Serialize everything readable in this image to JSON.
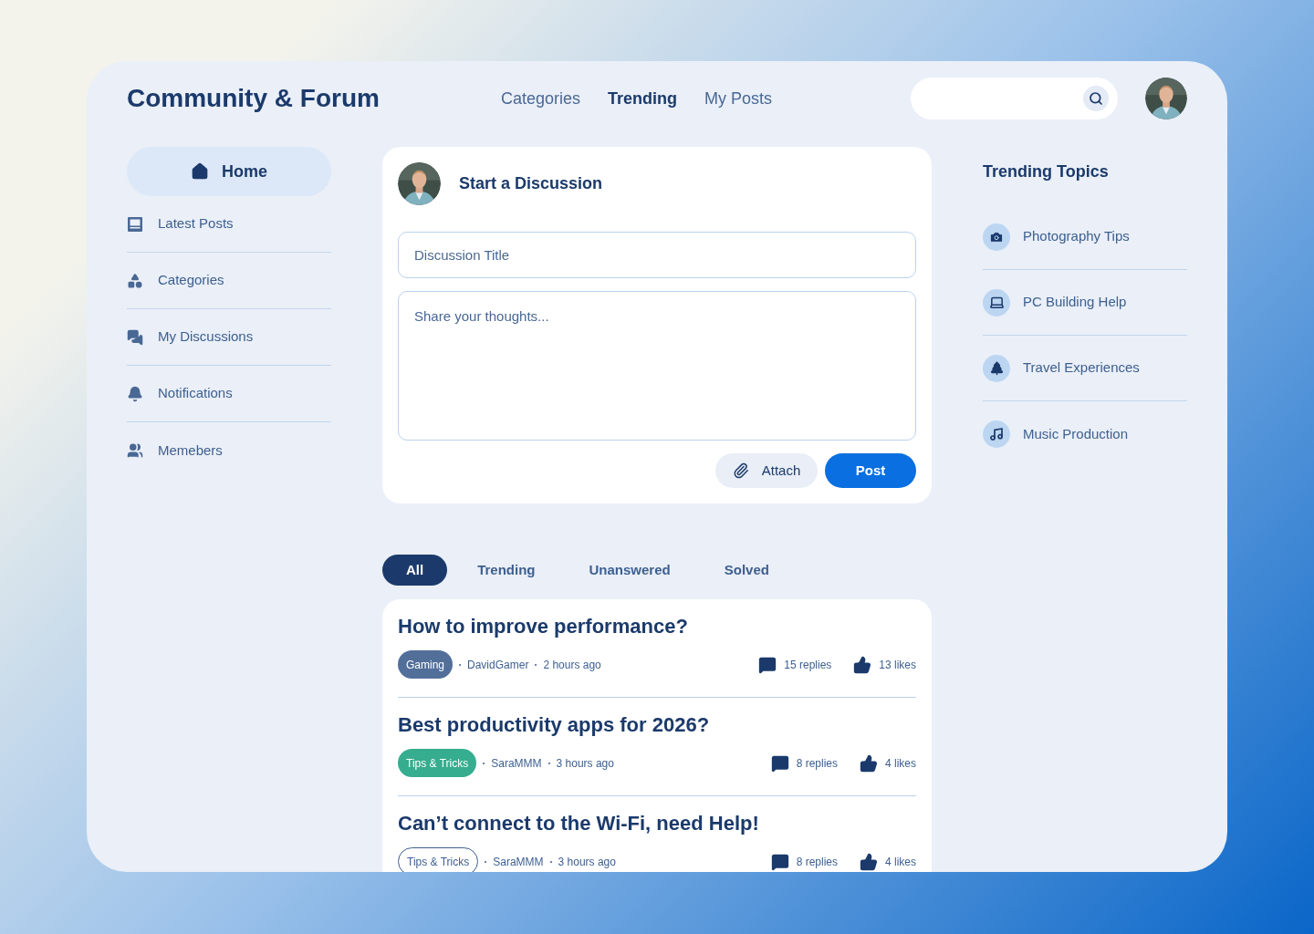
{
  "header": {
    "title": "Community & Forum",
    "nav": [
      {
        "label": "Categories",
        "selected": false
      },
      {
        "label": "Trending",
        "selected": true
      },
      {
        "label": "My Posts",
        "selected": false
      }
    ]
  },
  "sidebar": {
    "items": [
      {
        "label": "Home",
        "selected": true
      },
      {
        "label": "Latest Posts",
        "selected": false
      },
      {
        "label": "Categories",
        "selected": false
      },
      {
        "label": "My Discussions",
        "selected": false
      },
      {
        "label": "Notifications",
        "selected": false
      },
      {
        "label": "Memebers",
        "selected": false
      }
    ]
  },
  "composer": {
    "title": "Start a Discussion",
    "title_field": {
      "placeholder": "Discussion Title"
    },
    "body_field": {
      "placeholder": "Share your thoughts..."
    },
    "attach_button": "Attach",
    "post_button": "Post"
  },
  "filters": [
    {
      "label": "All",
      "selected": true
    },
    {
      "label": "Trending",
      "selected": false
    },
    {
      "label": "Unanswered",
      "selected": false
    },
    {
      "label": "Solved",
      "selected": false
    }
  ],
  "posts": [
    {
      "title": "How to improve performance?",
      "tag": {
        "label": "Gaming",
        "kind": "filled",
        "color": "#526f9a"
      },
      "author": "DavidGamer",
      "time": "2 hours ago",
      "replies": "15 replies",
      "likes": "13 likes"
    },
    {
      "title": "Best productivity apps for 2026?",
      "tag": {
        "label": "Tips & Tricks",
        "kind": "filled",
        "color": "#36ad8e"
      },
      "author": "SaraMMM",
      "time": "3 hours ago",
      "replies": "8 replies",
      "likes": "4 likes"
    },
    {
      "title": "Can’t connect to the Wi-Fi, need Help!",
      "tag": {
        "label": "Tips & Tricks",
        "kind": "outline",
        "color": "#3d5f8f"
      },
      "author": "SaraMMM",
      "time": "3 hours ago",
      "replies": "8 replies",
      "likes": "4 likes"
    }
  ],
  "trending": {
    "title": "Trending Topics",
    "items": [
      "Photography Tips",
      "PC Building Help",
      "Travel Experiences",
      "Music Production"
    ]
  }
}
